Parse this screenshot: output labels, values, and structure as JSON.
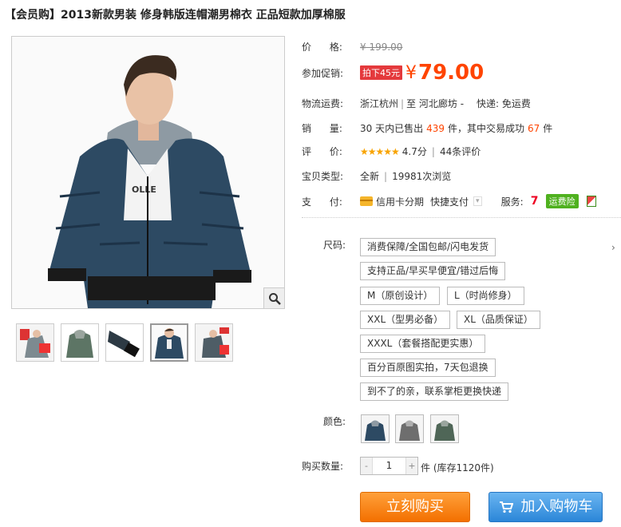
{
  "product": {
    "title": "【会员购】2013新款男装 修身韩版连帽潮男棉衣 正品短款加厚棉服"
  },
  "colors": {
    "accent_price": "#ff4400",
    "promo_tag_bg": "#e4393c",
    "buy_button": "#f37000",
    "cart_button": "#2b86d8",
    "stars": "#f8a300",
    "service_green": "#4fb11f"
  },
  "gallery": {
    "main_image_alt": "navy hooded puffer jacket on male model",
    "zoom_icon": "magnifier-icon",
    "thumbnails": [
      {
        "name": "thumb-1",
        "variant": "red-grey"
      },
      {
        "name": "thumb-2",
        "variant": "grey-green"
      },
      {
        "name": "thumb-3",
        "variant": "sleeve-detail"
      },
      {
        "name": "thumb-4",
        "variant": "navy",
        "active": true
      },
      {
        "name": "thumb-5",
        "variant": "red-grey-2"
      }
    ]
  },
  "info": {
    "price_label": "价      格:",
    "original_price": "¥ 199.00",
    "promo_label": "参加促销:",
    "promo_tag": "拍下45元",
    "yen": "¥",
    "promo_price": "79.00",
    "shipping_label": "物流运费:",
    "shipping_from": "浙江杭州",
    "shipping_sep": "|",
    "shipping_to": "至  河北廊坊 -",
    "shipping_method": "快递: 免运费",
    "sales_label": "销      量:",
    "sales_pre": "30 天内已售出",
    "sales_count": "439",
    "sales_mid": "件，其中交易成功",
    "sales_success": "67",
    "sales_unit": "件",
    "rating_label": "评      价:",
    "rating_stars": "★★★★★",
    "rating_score": "4.7分",
    "rating_sep": "|",
    "rating_reviews": "44条评价",
    "type_label": "宝贝类型:",
    "type_value": "全新",
    "type_sep": "|",
    "type_views": "19981次浏览",
    "pay_label": "支      付:",
    "pay_credit": "信用卡分期",
    "pay_quick": "快捷支付",
    "pay_dropdown": "▾",
    "service_label": "服务:",
    "service_seven": "7",
    "service_insurance": "运费险"
  },
  "sku": {
    "size_label": "尺码:",
    "options": [
      "消费保障/全国包邮/闪电发货",
      "支持正品/早买早便宜/错过后悔",
      "M（原创设计）",
      "L（时尚修身）",
      "XXL（型男必备）",
      "XL（品质保证）",
      "XXXL（套餐搭配更实惠）",
      "百分百原图实拍，7天包退换",
      "到不了的亲，联系掌柜更换快递"
    ],
    "more_arrow": "›",
    "color_label": "颜色:",
    "color_swatches": [
      "navy",
      "grey",
      "green"
    ]
  },
  "purchase": {
    "qty_label": "购买数量:",
    "qty_minus": "-",
    "qty_value": "1",
    "qty_plus": "+",
    "stock_text": "件 (库存1120件)",
    "buy_now": "立刻购买",
    "add_to_cart": "加入购物车"
  }
}
